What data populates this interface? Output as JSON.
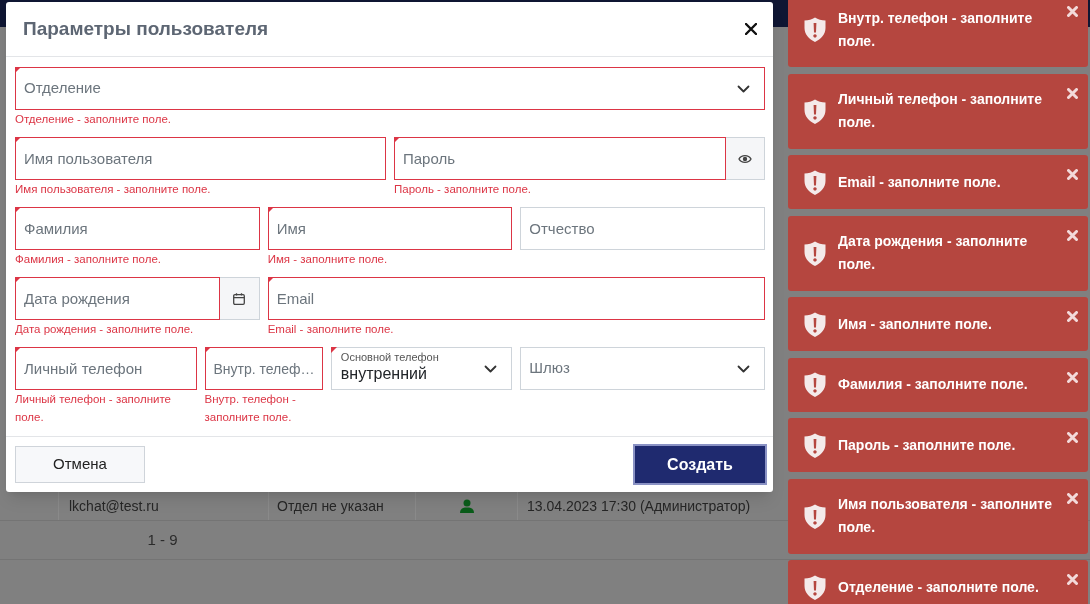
{
  "page": {
    "table_row": {
      "email": "lkchat@test.ru",
      "department": "Отдел не указан",
      "changed": "13.04.2023 17:30 (Администратор)"
    },
    "pagination": "1 - 9"
  },
  "dialog": {
    "title": "Параметры пользователя",
    "fields": [
      {
        "kind": "select",
        "placeholder": "Отделение",
        "required": true,
        "invalid": true,
        "error": "Отделение - заполните поле."
      },
      {
        "kind": "text",
        "placeholder": "Имя пользователя",
        "required": true,
        "invalid": true,
        "error": "Имя пользователя - заполните поле."
      },
      {
        "kind": "password",
        "placeholder": "Пароль",
        "required": true,
        "invalid": true,
        "error": "Пароль - заполните поле."
      },
      {
        "kind": "text",
        "placeholder": "Фамилия",
        "required": true,
        "invalid": true,
        "error": "Фамилия - заполните поле."
      },
      {
        "kind": "text",
        "placeholder": "Имя",
        "required": true,
        "invalid": true,
        "error": "Имя - заполните поле."
      },
      {
        "kind": "text",
        "placeholder": "Отчество",
        "required": false,
        "invalid": false
      },
      {
        "kind": "date",
        "placeholder": "Дата рождения",
        "required": true,
        "invalid": true,
        "error": "Дата рождения - заполните поле."
      },
      {
        "kind": "text",
        "placeholder": "Email",
        "required": true,
        "invalid": true,
        "error": "Email - заполните поле."
      },
      {
        "kind": "text",
        "placeholder": "Личный телефон",
        "required": true,
        "invalid": true,
        "error": "Личный телефон - заполните поле."
      },
      {
        "kind": "text",
        "placeholder": "Внутр. телеф…",
        "required": true,
        "invalid": true,
        "error": "Внутр. телефон - заполните поле."
      },
      {
        "kind": "select",
        "label": "Основной телефон",
        "value": "внутренний",
        "required": true,
        "invalid": false
      },
      {
        "kind": "select",
        "placeholder": "Шлюз",
        "required": false,
        "invalid": false
      }
    ],
    "buttons": [
      {
        "kind": "secondary",
        "label": "Отмена"
      },
      {
        "kind": "primary",
        "label": "Создать"
      }
    ]
  },
  "toasts": [
    {
      "text": "Внутр. телефон - заполните поле."
    },
    {
      "text": "Личный телефон - заполните поле."
    },
    {
      "text": "Email - заполните поле."
    },
    {
      "text": "Дата рождения - заполните поле."
    },
    {
      "text": "Имя - заполните поле."
    },
    {
      "text": "Фамилия - заполните поле."
    },
    {
      "text": "Пароль - заполните поле."
    },
    {
      "text": "Имя пользователя - заполните поле."
    },
    {
      "text": "Отделение - заполните поле."
    }
  ]
}
